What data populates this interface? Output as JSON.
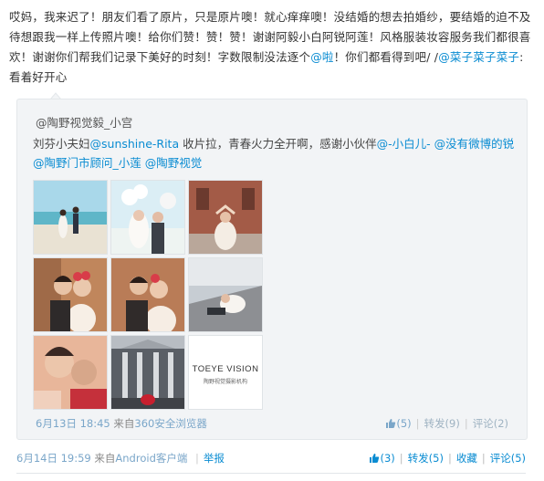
{
  "post": {
    "text_1": "哎妈，我来迟了！朋友们看了原片，只是原片噢！就心痒痒噢！没结婚的想去拍婚纱，要结婚的迫不及待想跟我一样上传照片噢！给你们赞！赞！赞！谢谢阿毅小白阿锐阿莲！风格服装妆容服务我们都很喜欢！谢谢你们帮我们记录下美好的时刻！字数限制没法逐个",
    "mention_1": "@啦",
    "text_2": "！你们都看得到吧/ /",
    "mention_2": "@菜子菜子菜子",
    "text_3": ":看着好开心"
  },
  "repost": {
    "author": "@陶野视觉毅_小宫",
    "text_1": "刘芬小夫妇",
    "mention_1": "@sunshine-Rita",
    "text_2": " 收片拉，青春火力全开啊，感谢小伙伴",
    "mention_2": "@-小白儿-",
    "mention_3": " @没有微博的锐",
    "mention_4": " @陶野门市顾问_小莲",
    "mention_5": " @陶野视觉",
    "logo_text": "TOEYE VISION",
    "logo_sub": "陶野视觉摄影机构",
    "date": "6月13日 18:45",
    "from_label": "来自",
    "source": "360安全浏览器",
    "like_count": "(5)",
    "repost_label": "转发(9)",
    "comment_label": "评论(2)"
  },
  "footer": {
    "date": "6月14日 19:59",
    "from_label": "来自",
    "source": "Android客户端",
    "report": "举报",
    "like_count": "(3)",
    "repost_label": "转发(5)",
    "favorite_label": "收藏",
    "comment_label": "评论(5)"
  },
  "colors": {
    "link": "#0a8cd2",
    "panel_bg": "#f2f4f6"
  }
}
